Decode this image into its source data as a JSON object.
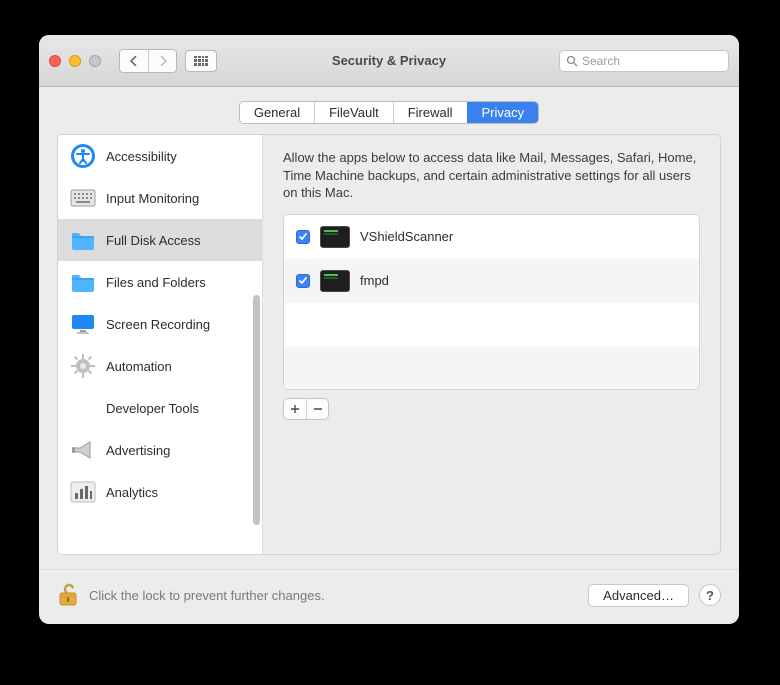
{
  "window": {
    "title": "Security & Privacy"
  },
  "search": {
    "placeholder": "Search"
  },
  "tabs": [
    {
      "label": "General",
      "active": false
    },
    {
      "label": "FileVault",
      "active": false
    },
    {
      "label": "Firewall",
      "active": false
    },
    {
      "label": "Privacy",
      "active": true
    }
  ],
  "sidebar": {
    "items": [
      {
        "label": "Accessibility",
        "icon": "accessibility",
        "selected": false
      },
      {
        "label": "Input Monitoring",
        "icon": "keyboard",
        "selected": false
      },
      {
        "label": "Full Disk Access",
        "icon": "folder",
        "selected": true
      },
      {
        "label": "Files and Folders",
        "icon": "folder",
        "selected": false
      },
      {
        "label": "Screen Recording",
        "icon": "display",
        "selected": false
      },
      {
        "label": "Automation",
        "icon": "gear",
        "selected": false
      },
      {
        "label": "Developer Tools",
        "icon": "none",
        "selected": false
      },
      {
        "label": "Advertising",
        "icon": "megaphone",
        "selected": false
      },
      {
        "label": "Analytics",
        "icon": "barchart",
        "selected": false
      }
    ]
  },
  "content": {
    "description": "Allow the apps below to access data like Mail, Messages, Safari, Home, Time Machine backups, and certain administrative settings for all users on this Mac.",
    "apps": [
      {
        "name": "VShieldScanner",
        "checked": true
      },
      {
        "name": "fmpd",
        "checked": true
      }
    ]
  },
  "footer": {
    "lock_text": "Click the lock to prevent further changes.",
    "advanced_label": "Advanced…",
    "help_label": "?"
  }
}
